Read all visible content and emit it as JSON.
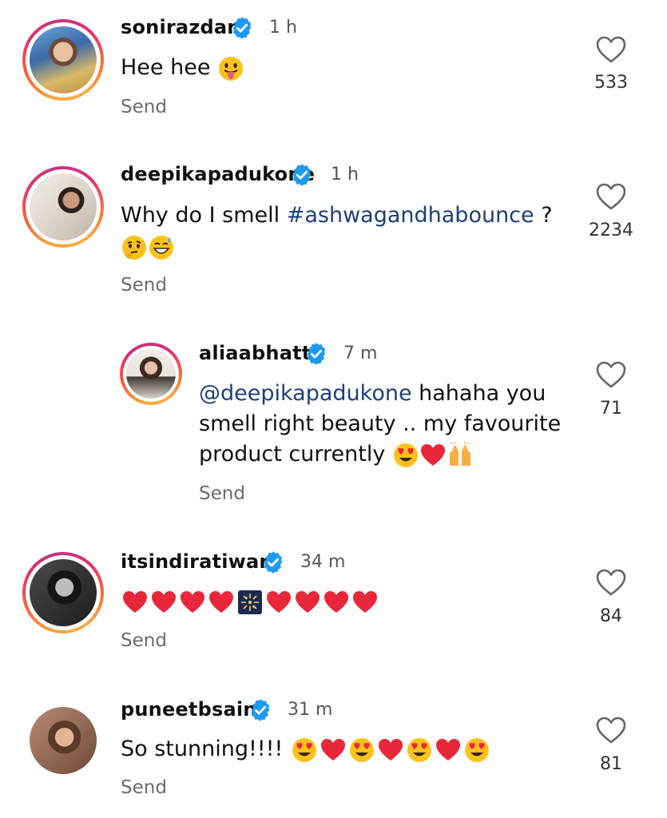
{
  "comments": [
    {
      "username": "sonirazdan",
      "time": "1 h",
      "text": "Hee hee",
      "emojis": [
        "tongue-face"
      ],
      "send_label": "Send",
      "likes": "533"
    },
    {
      "username": "deepikapadukone",
      "time": "1 h",
      "text_prefix": "Why do I smell ",
      "hashtag": "#ashwagandhabounce",
      "text_suffix": " ?",
      "emojis": [
        "thinking-face",
        "grinning-sweat-face"
      ],
      "send_label": "Send",
      "likes": "2234"
    },
    {
      "username": "aliaabhatt",
      "time": "7 m",
      "mention": "@deepikapadukone",
      "text_line1": " hahaha you",
      "text_line2": "smell right beauty .. my favourite",
      "text_line3": "product currently ",
      "emojis": [
        "heart-eyes-face",
        "red-heart",
        "raised-hands"
      ],
      "send_label": "Send",
      "likes": "71"
    },
    {
      "username": "itsindiratiwari",
      "time": "34 m",
      "emojis": [
        "red-heart",
        "red-heart",
        "red-heart",
        "red-heart",
        "fireworks",
        "red-heart",
        "red-heart",
        "red-heart",
        "red-heart"
      ],
      "send_label": "Send",
      "likes": "84"
    },
    {
      "username": "puneetbsaini",
      "time": "31 m",
      "text": "So stunning!!!! ",
      "emojis": [
        "heart-eyes-face",
        "red-heart",
        "heart-eyes-face",
        "red-heart",
        "heart-eyes-face",
        "red-heart",
        "heart-eyes-face"
      ],
      "send_label": "Send",
      "likes": "81"
    }
  ],
  "colors": {
    "verified_blue": "#1d9bf0",
    "mention_blue": "#1d3f7a",
    "heart_red": "#e8283a"
  },
  "icons": {
    "verified": "verified-badge-icon",
    "like": "heart-outline-icon"
  }
}
